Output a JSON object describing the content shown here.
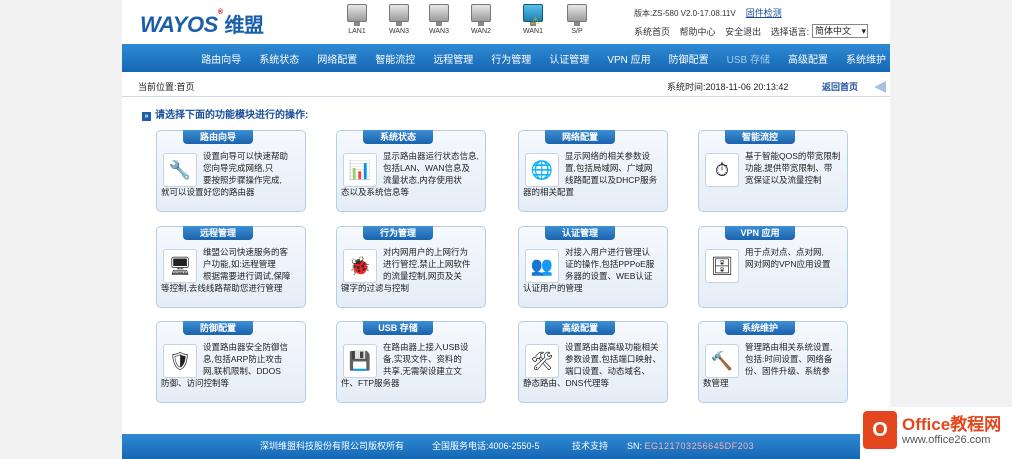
{
  "header": {
    "logo_text": "WAYOS",
    "logo_cn": "维盟",
    "logo_reg": "®",
    "ports": [
      {
        "label": "LAN1",
        "active": false,
        "warning": false
      },
      {
        "label": "WAN3",
        "active": false,
        "warning": false
      },
      {
        "label": "WAN3",
        "active": false,
        "warning": false
      },
      {
        "label": "WAN2",
        "active": false,
        "warning": false
      },
      {
        "label": "WAN1",
        "active": true,
        "warning": true
      },
      {
        "label": "S/P",
        "active": false,
        "warning": false
      }
    ],
    "version": "版本:ZS-580 V2.0-17.08.11V",
    "update_link": "固件检测",
    "links": [
      "系统首页",
      "帮助中心",
      "安全退出",
      "选择语言:"
    ],
    "language": "简体中文"
  },
  "nav": [
    "路由向导",
    "系统状态",
    "网络配置",
    "智能流控",
    "远程管理",
    "行为管理",
    "认证管理",
    "VPN 应用",
    "防御配置",
    "USB 存储",
    "高级配置",
    "系统维护"
  ],
  "breadcrumb": {
    "location": "当前位置:首页",
    "time": "系统时间:2018-11-06 20:13:42",
    "back": "返回首页"
  },
  "prompt": "请选择下面的功能模块进行的操作:",
  "cards": [
    {
      "title": "路由向导",
      "icon": "wrench-keys-icon",
      "symbol": "🔧",
      "line1": "设置向导可以快速帮助",
      "line2": "您向导完成网络,只",
      "line3": "要按照步骤操作完成,",
      "line4": "就可以设置好您的路由器"
    },
    {
      "title": "系统状态",
      "icon": "status-chart-icon",
      "symbol": "📊",
      "line1": "显示路由器运行状态信息,",
      "line2": "包括LAN、WAN信息及",
      "line3": "流量状态,内存使用状",
      "line4": "态以及系统信息等"
    },
    {
      "title": "网络配置",
      "icon": "globe-icon",
      "symbol": "🌐",
      "line1": "显示网络的相关参数设",
      "line2": "置,包括局域网、广域网",
      "line3": "线路配置以及DHCP服务",
      "line4": "器的相关配置"
    },
    {
      "title": "智能流控",
      "icon": "meter-icon",
      "symbol": "⏱",
      "line1": "基于智能QOS的带宽限制",
      "line2": "功能,提供带宽限制、带",
      "line3": "宽保证以及流量控制",
      "line4": ""
    },
    {
      "title": "远程管理",
      "icon": "remote-pc-icon",
      "symbol": "🖥",
      "line1": "维盟公司快速服务的客",
      "line2": "户功能,如:远程管理",
      "line3": "根据需要进行调试,保障",
      "line4": "等控制,去线线路帮助您进行管理"
    },
    {
      "title": "行为管理",
      "icon": "ladybug-icon",
      "symbol": "🐞",
      "line1": "对内网用户的上网行为",
      "line2": "进行管控,禁止上网软件",
      "line3": "的流量控制,网页及关",
      "line4": "键字的过滤与控制"
    },
    {
      "title": "认证管理",
      "icon": "users-icon",
      "symbol": "👥",
      "line1": "对接入用户进行管理认",
      "line2": "证的操作,包括PPPoE服",
      "line3": "务器的设置、WEB认证",
      "line4": "认证用户的管理"
    },
    {
      "title": "VPN 应用",
      "icon": "server-icon",
      "symbol": "🗄",
      "line1": "用于点对点、点对网,",
      "line2": "网对网的VPN应用设置",
      "line3": "",
      "line4": ""
    },
    {
      "title": "防御配置",
      "icon": "shield-icon",
      "symbol": "🛡",
      "line1": "设置路由器安全防御信",
      "line2": "息,包括ARP防止攻击",
      "line3": "网,联机限制、DDOS",
      "line4": "防御、访问控制等"
    },
    {
      "title": "USB 存储",
      "icon": "usb-disk-icon",
      "symbol": "💾",
      "line1": "在路由器上接入USB设",
      "line2": "备,实现文件、资料的",
      "line3": "共享,无需架设建立文",
      "line4": "件、FTP服务器"
    },
    {
      "title": "高级配置",
      "icon": "tools-icon",
      "symbol": "🛠",
      "line1": "设置路由器高级功能相关",
      "line2": "参数设置,包括端口映射、",
      "line3": "端口设置、动态域名、",
      "line4": "静态路由、DNS代理等"
    },
    {
      "title": "系统维护",
      "icon": "maintenance-icon",
      "symbol": "🔨",
      "line1": "管理路由相关系统设置,",
      "line2": "包括:时间设置、网络备",
      "line3": "份、固件升级、系统参",
      "line4": "数管理"
    }
  ],
  "footer": {
    "copyright": "深圳维盟科技股份有限公司版权所有",
    "tel": "全国服务电话:4006-2550-5",
    "support": "技术支持",
    "sn_label": "SN:",
    "sn_value": "EG121703256645DF203"
  },
  "watermark": {
    "title_en": "Office",
    "title_cn": "教程网",
    "url": "www.office26.com"
  }
}
